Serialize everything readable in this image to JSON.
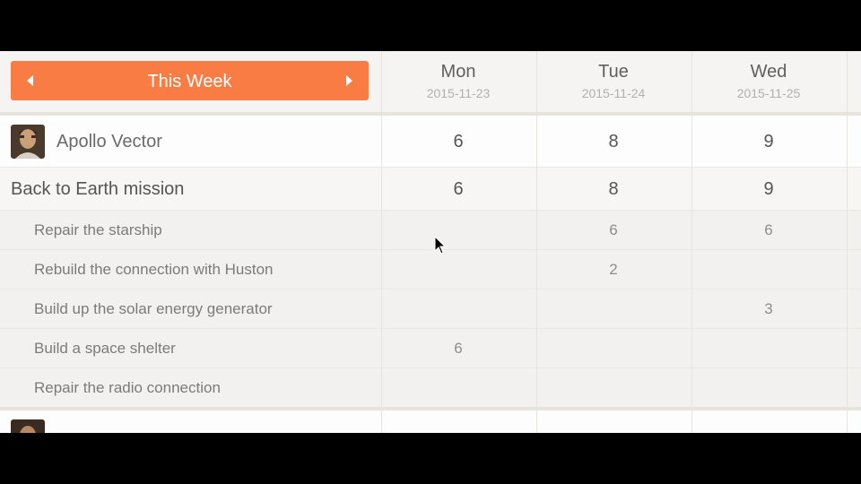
{
  "header": {
    "week_label": "This Week",
    "days": [
      {
        "name": "Mon",
        "date": "2015-11-23"
      },
      {
        "name": "Tue",
        "date": "2015-11-24"
      },
      {
        "name": "Wed",
        "date": "2015-11-25"
      }
    ]
  },
  "person1": {
    "name": "Apollo Vector",
    "hours": [
      "6",
      "8",
      "9"
    ]
  },
  "project": {
    "name": "Back to Earth mission",
    "hours": [
      "6",
      "8",
      "9"
    ]
  },
  "tasks": [
    {
      "name": "Repair the starship",
      "hours": [
        "",
        "6",
        "6"
      ]
    },
    {
      "name": "Rebuild the connection with Huston",
      "hours": [
        "",
        "2",
        ""
      ]
    },
    {
      "name": "Build up the solar energy generator",
      "hours": [
        "",
        "",
        "3"
      ]
    },
    {
      "name": "Build a space shelter",
      "hours": [
        "6",
        "",
        ""
      ]
    },
    {
      "name": "Repair the radio connection",
      "hours": [
        "",
        "",
        ""
      ]
    }
  ],
  "colors": {
    "accent": "#f97c45",
    "background": "#f6f4f2"
  }
}
